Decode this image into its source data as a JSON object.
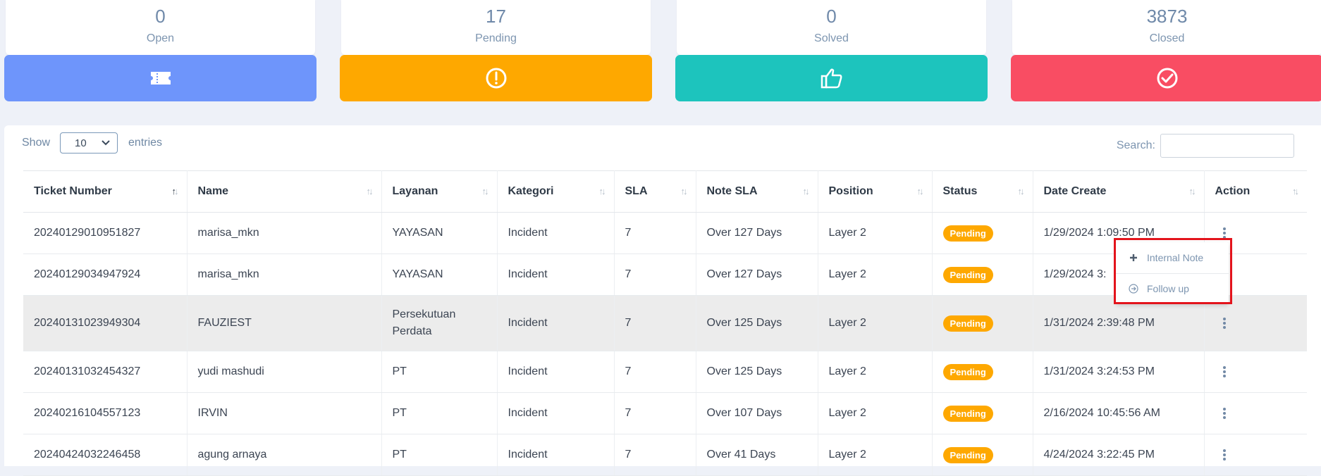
{
  "cards": [
    {
      "count": "0",
      "label": "Open",
      "color": "#6e95fb",
      "icon": "ticket-icon"
    },
    {
      "count": "17",
      "label": "Pending",
      "color": "#fea800",
      "icon": "alert-circle-icon"
    },
    {
      "count": "0",
      "label": "Solved",
      "color": "#1dc4bd",
      "icon": "thumbs-up-icon"
    },
    {
      "count": "3873",
      "label": "Closed",
      "color": "#f94d63",
      "icon": "check-circle-icon"
    }
  ],
  "controls": {
    "show_label": "Show",
    "entries_value": "10",
    "entries_label": "entries",
    "search_label": "Search:"
  },
  "table": {
    "headers": [
      "Ticket Number",
      "Name",
      "Layanan",
      "Kategori",
      "SLA",
      "Note SLA",
      "Position",
      "Status",
      "Date Create",
      "Action"
    ],
    "rows": [
      {
        "ticket": "20240129010951827",
        "name": "marisa_mkn",
        "layanan": "YAYASAN",
        "kategori": "Incident",
        "sla": "7",
        "note_sla": "Over 127 Days",
        "position": "Layer 2",
        "status": "Pending",
        "date": "1/29/2024 1:09:50 PM"
      },
      {
        "ticket": "20240129034947924",
        "name": "marisa_mkn",
        "layanan": "YAYASAN",
        "kategori": "Incident",
        "sla": "7",
        "note_sla": "Over 127 Days",
        "position": "Layer 2",
        "status": "Pending",
        "date": "1/29/2024 3:"
      },
      {
        "ticket": "20240131023949304",
        "name": "FAUZIEST",
        "layanan": "Persekutuan Perdata",
        "kategori": "Incident",
        "sla": "7",
        "note_sla": "Over 125 Days",
        "position": "Layer 2",
        "status": "Pending",
        "date": "1/31/2024 2:39:48 PM"
      },
      {
        "ticket": "20240131032454327",
        "name": "yudi mashudi",
        "layanan": "PT",
        "kategori": "Incident",
        "sla": "7",
        "note_sla": "Over 125 Days",
        "position": "Layer 2",
        "status": "Pending",
        "date": "1/31/2024 3:24:53 PM"
      },
      {
        "ticket": "20240216104557123",
        "name": "IRVIN",
        "layanan": "PT",
        "kategori": "Incident",
        "sla": "7",
        "note_sla": "Over 107 Days",
        "position": "Layer 2",
        "status": "Pending",
        "date": "2/16/2024 10:45:56 AM"
      },
      {
        "ticket": "20240424032246458",
        "name": "agung arnaya",
        "layanan": "PT",
        "kategori": "Incident",
        "sla": "7",
        "note_sla": "Over 41 Days",
        "position": "Layer 2",
        "status": "Pending",
        "date": "4/24/2024 3:22:45 PM"
      }
    ]
  },
  "dropdown": {
    "items": [
      {
        "label": "Internal Note",
        "icon": "plus-icon"
      },
      {
        "label": "Follow up",
        "icon": "arrow-circle-right-icon"
      }
    ]
  },
  "colors": {
    "pending_badge": "#fea800",
    "highlight_box": "#e3141c"
  }
}
